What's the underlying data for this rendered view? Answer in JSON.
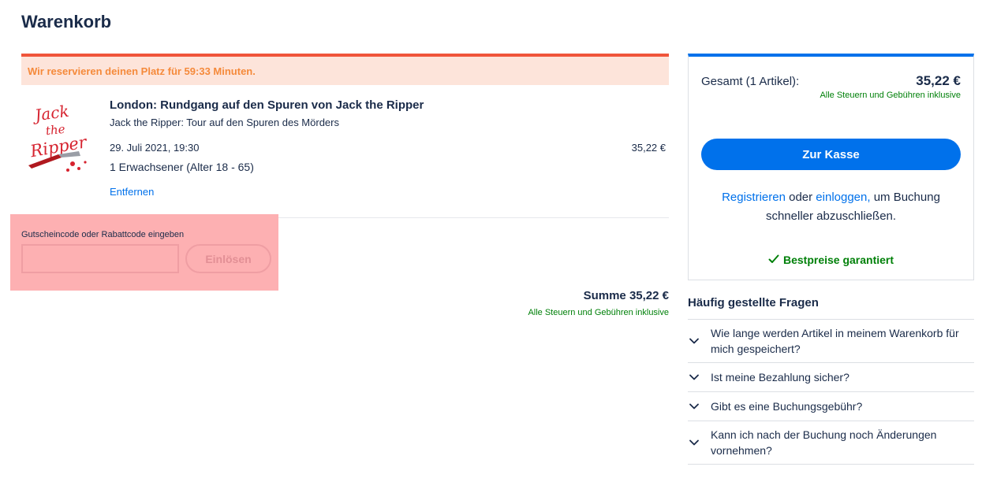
{
  "page": {
    "title": "Warenkorb"
  },
  "timer": {
    "text": "Wir reservieren deinen Platz für 59:33 Minuten."
  },
  "cart_item": {
    "image_text": "Jack the Ripper",
    "title": "London: Rundgang auf den Spuren von Jack the Ripper",
    "subtitle": "Jack the Ripper: Tour auf den Spuren des Mörders",
    "date": "29. Juli 2021, 19:30",
    "participants": "1 Erwachsener (Alter 18 - 65)",
    "price": "35,22 €",
    "remove_label": "Entfernen"
  },
  "promo": {
    "label": "Gutscheincode oder Rabattcode eingeben",
    "value": "",
    "button_label": "Einlösen"
  },
  "sum": {
    "label": "Summe 35,22 €",
    "tax_note": "Alle Steuern und Gebühren inklusive"
  },
  "summary": {
    "total_label": "Gesamt (1 Artikel):",
    "total_value": "35,22 €",
    "tax_note": "Alle Steuern und Gebühren inklusive",
    "checkout_label": "Zur Kasse",
    "register_link": "Registrieren",
    "or_text": " oder ",
    "login_link": "einloggen,",
    "signin_suffix": " um Buchung schneller abzuschließen.",
    "best_price": "Bestpreise garantiert"
  },
  "faq": {
    "title": "Häufig gestellte Fragen",
    "items": [
      {
        "question": "Wie lange werden Artikel in meinem Warenkorb für mich gespeichert?"
      },
      {
        "question": "Ist meine Bezahlung sicher?"
      },
      {
        "question": "Gibt es eine Buchungsgebühr?"
      },
      {
        "question": "Kann ich nach der Buchung noch Änderungen vornehmen?"
      }
    ]
  },
  "colors": {
    "primary": "#0071eb",
    "success": "#008009",
    "timer_accent": "#f0553a",
    "timer_bg": "#fde4da",
    "promo_highlight": "#fdb0b2",
    "text": "#1a2b49"
  },
  "icons": {
    "chevron": "chevron-down-icon",
    "check": "check-icon",
    "product_logo": "jack-the-ripper-logo"
  }
}
